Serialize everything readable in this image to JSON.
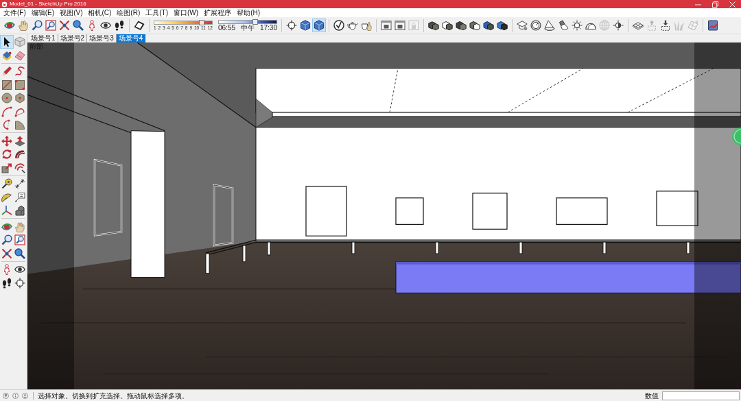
{
  "window": {
    "title": "Model_01 - SketchUp Pro 2016"
  },
  "menu": [
    "文件(F)",
    "编辑(E)",
    "视图(V)",
    "相机(C)",
    "绘图(R)",
    "工具(T)",
    "窗口(W)",
    "扩展程序",
    "帮助(H)"
  ],
  "toolbar": [
    {
      "kind": "icons",
      "items": [
        {
          "selected": false,
          "disabled": false
        },
        {
          "selected": false,
          "disabled": false
        },
        {
          "selected": false,
          "disabled": false
        },
        {
          "selected": false,
          "disabled": false
        },
        {
          "selected": false,
          "disabled": false
        },
        {
          "selected": false,
          "disabled": false
        },
        {
          "selected": false,
          "disabled": false
        },
        {
          "selected": false,
          "disabled": false
        },
        {
          "selected": false,
          "disabled": false
        }
      ]
    },
    {
      "kind": "icons",
      "items": [
        {
          "selected": false,
          "disabled": false
        }
      ]
    },
    {
      "kind": "sliders",
      "sliders": [
        {
          "level": 0.86,
          "labels": [
            "1",
            "2",
            "3",
            "4",
            "5",
            "6",
            "7",
            "8",
            "9",
            "10",
            "11",
            "12"
          ]
        },
        {
          "level": 0.65,
          "labels": [
            "06:55",
            "中午",
            "17:30"
          ]
        }
      ]
    },
    {
      "kind": "icons",
      "items": [
        {
          "selected": false,
          "disabled": false
        },
        {
          "selected": false,
          "disabled": false
        },
        {
          "selected": true,
          "disabled": false
        }
      ]
    },
    {
      "kind": "icons",
      "items": [
        {
          "selected": false,
          "disabled": false
        },
        {
          "selected": false,
          "disabled": false
        },
        {
          "selected": false,
          "disabled": false
        }
      ]
    },
    {
      "kind": "icons",
      "items": [
        {
          "selected": false,
          "disabled": false
        },
        {
          "selected": false,
          "disabled": false
        },
        {
          "selected": false,
          "disabled": true
        }
      ]
    },
    {
      "kind": "icons",
      "items": [
        {
          "selected": false,
          "disabled": false
        },
        {
          "selected": false,
          "disabled": false
        },
        {
          "selected": false,
          "disabled": false
        },
        {
          "selected": false,
          "disabled": false
        },
        {
          "selected": false,
          "disabled": false
        },
        {
          "selected": false,
          "disabled": false
        }
      ]
    },
    {
      "kind": "icons",
      "items": [
        {
          "selected": false,
          "disabled": false
        },
        {
          "selected": false,
          "disabled": false
        },
        {
          "selected": false,
          "disabled": false
        },
        {
          "selected": false,
          "disabled": false
        },
        {
          "selected": false,
          "disabled": false
        },
        {
          "selected": false,
          "disabled": false
        },
        {
          "selected": false,
          "disabled": true
        },
        {
          "selected": false,
          "disabled": false
        }
      ]
    },
    {
      "kind": "icons",
      "items": [
        {
          "selected": false,
          "disabled": false
        },
        {
          "selected": false,
          "disabled": true
        },
        {
          "selected": false,
          "disabled": false
        },
        {
          "selected": false,
          "disabled": true
        },
        {
          "selected": false,
          "disabled": true
        }
      ]
    },
    {
      "kind": "icons",
      "items": [
        {
          "selected": false,
          "disabled": false
        }
      ]
    }
  ],
  "scenes": [
    {
      "label": "场景号1",
      "selected": false
    },
    {
      "label": "场景号2",
      "selected": false
    },
    {
      "label": "场景号3",
      "selected": false
    },
    {
      "label": "场景号4",
      "selected": true
    }
  ],
  "tool_palette": [
    {
      "items": [
        {
          "selected": true,
          "disabled": false
        },
        {
          "selected": false,
          "disabled": false
        },
        {
          "selected": false,
          "disabled": false
        },
        {
          "selected": false,
          "disabled": false
        }
      ]
    },
    {
      "items": [
        {
          "selected": false,
          "disabled": false
        },
        {
          "selected": false,
          "disabled": false
        },
        {
          "selected": false,
          "disabled": false
        },
        {
          "selected": false,
          "disabled": false
        },
        {
          "selected": false,
          "disabled": false
        },
        {
          "selected": false,
          "disabled": false
        },
        {
          "selected": false,
          "disabled": false
        },
        {
          "selected": false,
          "disabled": false
        },
        {
          "selected": false,
          "disabled": false
        },
        {
          "selected": false,
          "disabled": false
        }
      ]
    },
    {
      "items": [
        {
          "selected": false,
          "disabled": false
        },
        {
          "selected": false,
          "disabled": false
        },
        {
          "selected": false,
          "disabled": false
        },
        {
          "selected": false,
          "disabled": false
        },
        {
          "selected": false,
          "disabled": false
        },
        {
          "selected": false,
          "disabled": false
        }
      ]
    },
    {
      "items": [
        {
          "selected": false,
          "disabled": false
        },
        {
          "selected": false,
          "disabled": false
        },
        {
          "selected": false,
          "disabled": false
        },
        {
          "selected": false,
          "disabled": false
        },
        {
          "selected": false,
          "disabled": false
        },
        {
          "selected": false,
          "disabled": false
        }
      ]
    },
    {
      "items": [
        {
          "selected": false,
          "disabled": false
        },
        {
          "selected": false,
          "disabled": false
        },
        {
          "selected": false,
          "disabled": false
        },
        {
          "selected": false,
          "disabled": false
        },
        {
          "selected": false,
          "disabled": false
        },
        {
          "selected": false,
          "disabled": false
        }
      ]
    },
    {
      "items": [
        {
          "selected": false,
          "disabled": false
        },
        {
          "selected": false,
          "disabled": false
        },
        {
          "selected": false,
          "disabled": false
        },
        {
          "selected": false,
          "disabled": false
        }
      ]
    }
  ],
  "viewport": {
    "view_label": "前部"
  },
  "status_bar": {
    "message": "选择对象。切换到扩充选择。拖动鼠标选择多项。",
    "measurements_label": "数值"
  }
}
